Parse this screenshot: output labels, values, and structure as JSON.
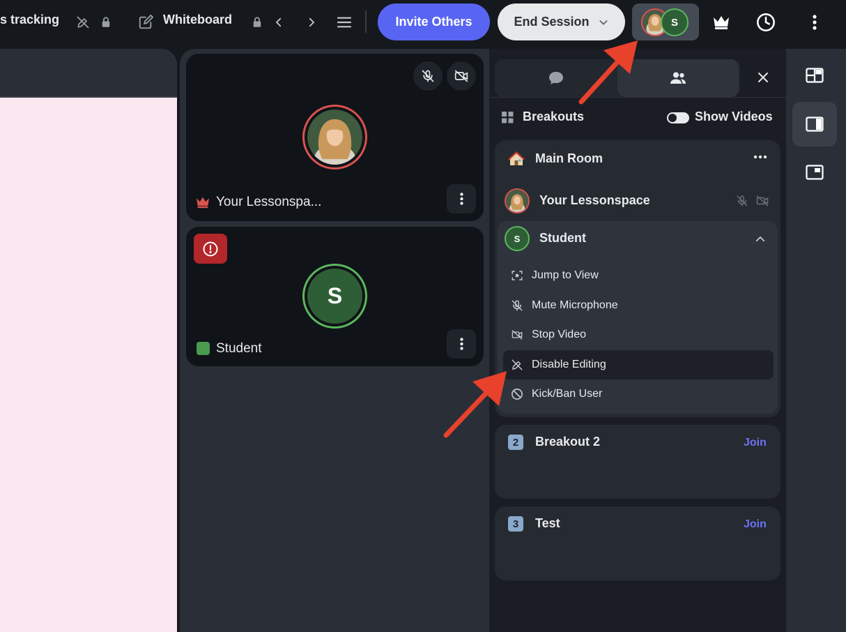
{
  "topbar": {
    "tab1_title": "s tracking",
    "tab2_title": "Whiteboard",
    "invite_label": "Invite Others",
    "end_session_label": "End Session",
    "avatar_student_initial": "S"
  },
  "video": {
    "tile1_name": "Your Lessonspa...",
    "tile2_name": "Student",
    "tile2_initial": "S"
  },
  "panel": {
    "breakouts_label": "Breakouts",
    "show_videos_label": "Show Videos",
    "main_room": {
      "title": "Main Room",
      "participants": [
        {
          "name": "Your Lessonspace"
        },
        {
          "name": "Student",
          "initial": "S"
        }
      ]
    },
    "menu_items": [
      {
        "label": "Jump to View"
      },
      {
        "label": "Mute Microphone"
      },
      {
        "label": "Stop Video"
      },
      {
        "label": "Disable Editing"
      },
      {
        "label": "Kick/Ban User"
      }
    ],
    "rooms": [
      {
        "number": "2",
        "title": "Breakout 2",
        "join_label": "Join"
      },
      {
        "number": "3",
        "title": "Test",
        "join_label": "Join"
      }
    ]
  },
  "colors": {
    "accent": "#5865f2",
    "host_ring": "#d9534f",
    "student_ring": "#5cb85c",
    "student_fill": "#2e5e36",
    "alert_red": "#b3262a",
    "annotation_arrow": "#e8412c",
    "canvas": "#fbe7f0"
  }
}
